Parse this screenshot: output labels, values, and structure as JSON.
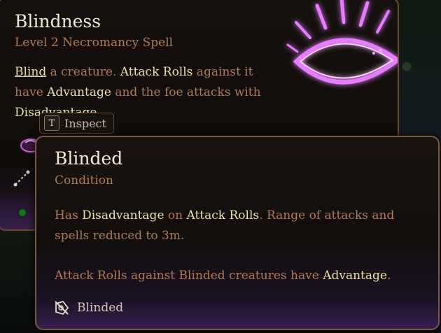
{
  "spell": {
    "title": "Blindness",
    "subtitle": "Level 2 Necromancy Spell",
    "desc": {
      "link": "Blind",
      "t1": " a creature. ",
      "h1": "Attack Rolls",
      "t2": " against it have ",
      "h2": "Advantage",
      "t3": " and the foe attacks with ",
      "h3": "Disadvantage",
      "t4": "."
    }
  },
  "inspect": {
    "key": "T",
    "label": "Inspect"
  },
  "condition": {
    "title": "Blinded",
    "subtitle": "Condition",
    "p1": {
      "t1": "Has ",
      "h1": "Disadvantage",
      "t2": " on ",
      "h2": "Attack Rolls",
      "t3": ". Range of attacks and spells reduced to 3m."
    },
    "p2": {
      "t1": "Attack Rolls against Blinded creatures have ",
      "h1": "Advantage",
      "t2": "."
    },
    "footer": {
      "icon": "blinded-icon",
      "label": "Blinded"
    }
  },
  "colors": {
    "title": "#f4ead8",
    "body": "#b07b52",
    "highlight": "#ebe2a2",
    "border": "#7a5840",
    "glow": "#e070ff"
  }
}
